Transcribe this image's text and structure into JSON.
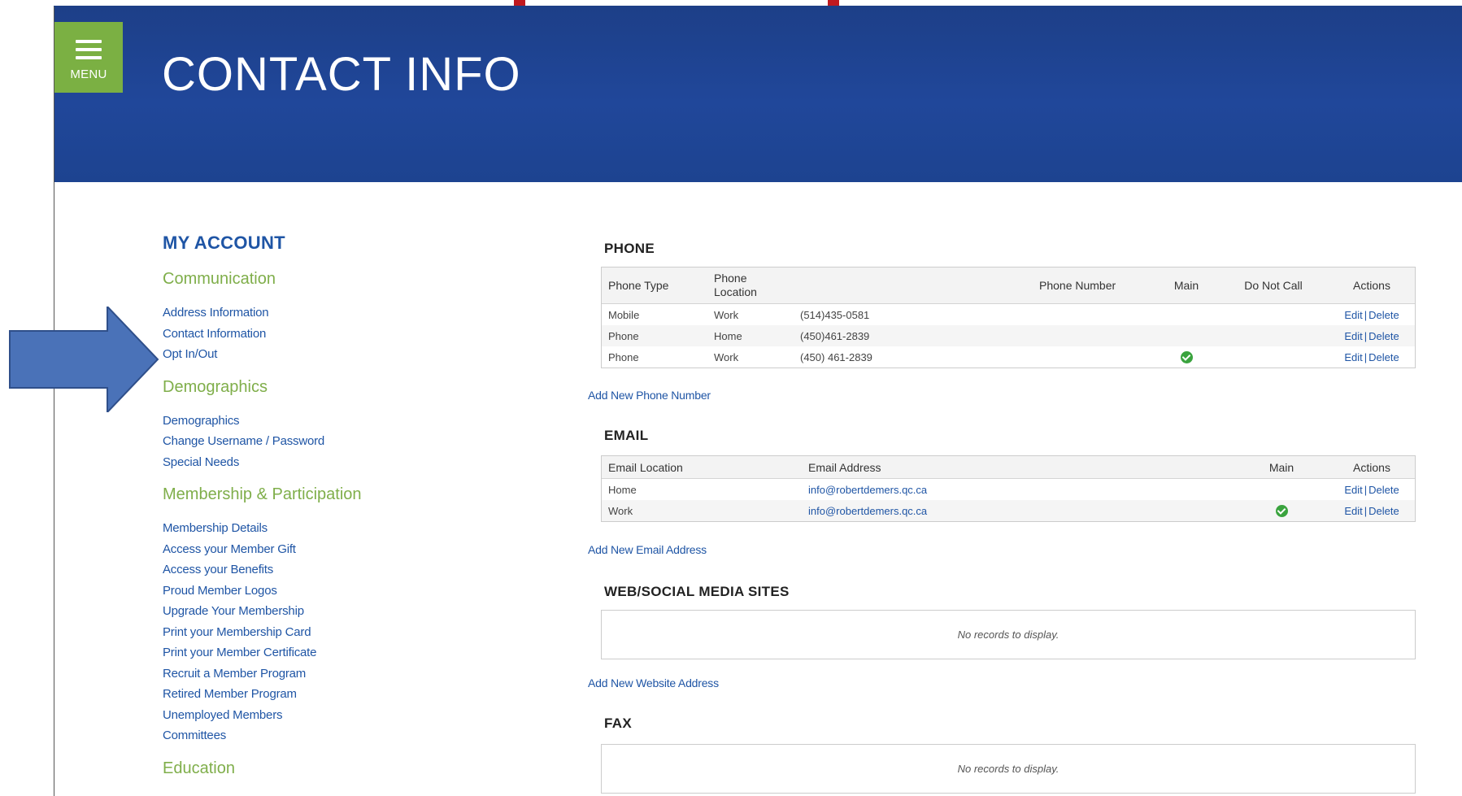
{
  "header": {
    "menu_label": "MENU",
    "title": "CONTACT INFO"
  },
  "sidebar": {
    "heading": "MY ACCOUNT",
    "sections": [
      {
        "title": "Communication",
        "links": [
          "Address Information",
          "Contact Information",
          "Opt In/Out"
        ]
      },
      {
        "title": "Demographics",
        "links": [
          "Demographics",
          "Change Username / Password",
          "Special Needs"
        ]
      },
      {
        "title": "Membership & Participation",
        "links": [
          "Membership Details",
          "Access your Member Gift",
          "Access your Benefits",
          "Proud Member Logos",
          "Upgrade Your Membership",
          "Print your Membership Card",
          "Print your Member Certificate",
          "Recruit a Member Program",
          "Retired Member Program",
          "Unemployed Members",
          "Committees"
        ]
      },
      {
        "title": "Education",
        "links": []
      }
    ]
  },
  "phone": {
    "title": "PHONE",
    "headers": {
      "type": "Phone Type",
      "location": "Phone Location",
      "number": "Phone Number",
      "main": "Main",
      "dnc": "Do Not Call",
      "actions": "Actions"
    },
    "rows": [
      {
        "type": "Mobile",
        "location": "Work",
        "number": "(514)435-0581",
        "main": false
      },
      {
        "type": "Phone",
        "location": "Home",
        "number": "(450)461-2839",
        "main": false
      },
      {
        "type": "Phone",
        "location": "Work",
        "number": "(450) 461-2839",
        "main": true
      }
    ],
    "add_label": "Add New Phone Number"
  },
  "email": {
    "title": "EMAIL",
    "headers": {
      "location": "Email Location",
      "address": "Email Address",
      "main": "Main",
      "actions": "Actions"
    },
    "rows": [
      {
        "location": "Home",
        "address": "info@robertdemers.qc.ca",
        "main": false
      },
      {
        "location": "Work",
        "address": "info@robertdemers.qc.ca",
        "main": true
      }
    ],
    "add_label": "Add New Email Address"
  },
  "web": {
    "title": "WEB/SOCIAL MEDIA SITES",
    "empty": "No records to display.",
    "add_label": "Add New Website Address"
  },
  "fax": {
    "title": "FAX",
    "empty": "No records to display."
  },
  "actions": {
    "edit": "Edit",
    "delete": "Delete",
    "sep": "|"
  },
  "colors": {
    "banner": "#1d3f88",
    "menu": "#7bb043",
    "link": "#1f55a5",
    "section": "#7fae4a",
    "arrow": "#4a72b8"
  }
}
